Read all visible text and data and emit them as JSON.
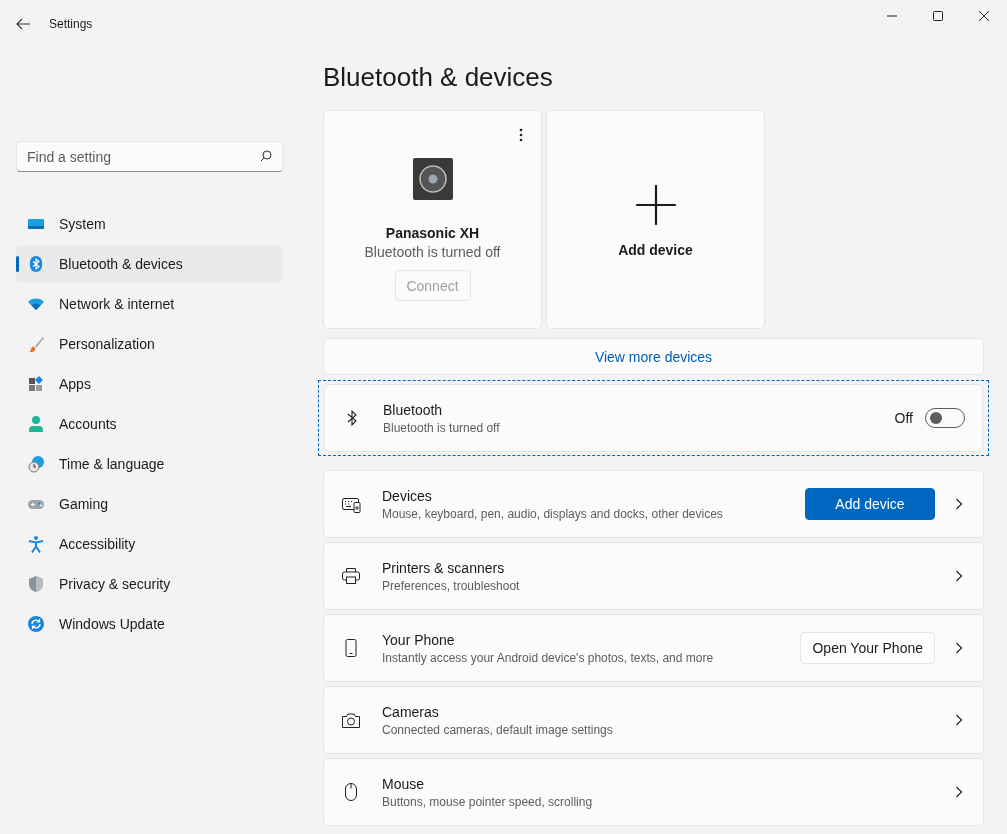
{
  "window": {
    "title": "Settings"
  },
  "search": {
    "placeholder": "Find a setting"
  },
  "sidebar": {
    "items": [
      {
        "label": "System",
        "selected": false
      },
      {
        "label": "Bluetooth & devices",
        "selected": true
      },
      {
        "label": "Network & internet",
        "selected": false
      },
      {
        "label": "Personalization",
        "selected": false
      },
      {
        "label": "Apps",
        "selected": false
      },
      {
        "label": "Accounts",
        "selected": false
      },
      {
        "label": "Time & language",
        "selected": false
      },
      {
        "label": "Gaming",
        "selected": false
      },
      {
        "label": "Accessibility",
        "selected": false
      },
      {
        "label": "Privacy & security",
        "selected": false
      },
      {
        "label": "Windows Update",
        "selected": false
      }
    ]
  },
  "page_title": "Bluetooth & devices",
  "device_card": {
    "name": "Panasonic XH",
    "status": "Bluetooth is turned off",
    "button": {
      "label": "Connect",
      "disabled": true
    }
  },
  "add_device_card": {
    "label": "Add device"
  },
  "view_more": "View more devices",
  "bluetooth": {
    "title": "Bluetooth",
    "subtitle": "Bluetooth is turned off",
    "state_label": "Off",
    "on": false,
    "focused": true
  },
  "rows": [
    {
      "title": "Devices",
      "subtitle": "Mouse, keyboard, pen, audio, displays and docks, other devices",
      "button": {
        "label": "Add device",
        "kind": "primary"
      }
    },
    {
      "title": "Printers & scanners",
      "subtitle": "Preferences, troubleshoot"
    },
    {
      "title": "Your Phone",
      "subtitle": "Instantly access your Android device's photos, texts, and more",
      "button": {
        "label": "Open Your Phone",
        "kind": "secondary"
      }
    },
    {
      "title": "Cameras",
      "subtitle": "Connected cameras, default image settings"
    },
    {
      "title": "Mouse",
      "subtitle": "Buttons, mouse pointer speed, scrolling"
    }
  ]
}
